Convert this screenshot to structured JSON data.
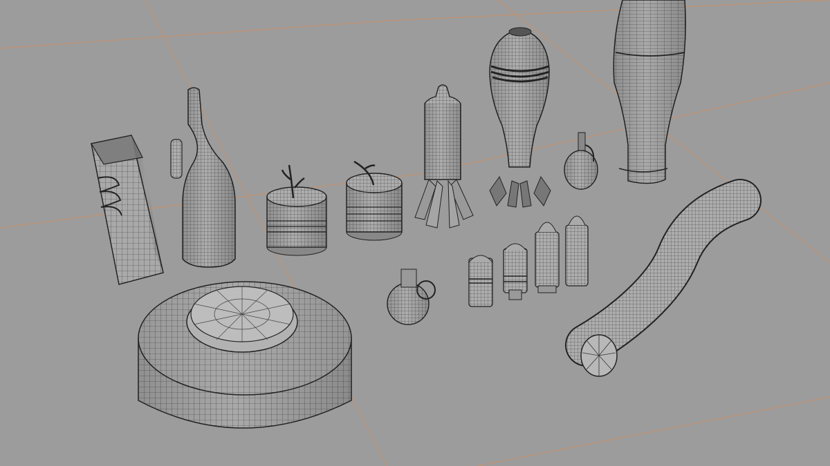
{
  "viewport": {
    "background": "#9c9c9c",
    "grid_color": "#c9926a",
    "mesh_fill": "#a9a9a9",
    "mesh_shade": "#8e8e8e",
    "wire_color": "#2a2a2a"
  },
  "objects": [
    {
      "name": "anti-tank-mine",
      "icon": "landmine-mesh"
    },
    {
      "name": "molotov-bottle",
      "icon": "bottle-mesh"
    },
    {
      "name": "juice-carton-bomb",
      "icon": "carton-mesh"
    },
    {
      "name": "improvised-charge-left",
      "icon": "charge-mesh"
    },
    {
      "name": "improvised-charge-right",
      "icon": "charge-mesh"
    },
    {
      "name": "rocket-projectile",
      "icon": "rocket-mesh"
    },
    {
      "name": "mortar-shell",
      "icon": "mortar-mesh"
    },
    {
      "name": "artillery-shell",
      "icon": "shell-mesh"
    },
    {
      "name": "pineapple-grenade",
      "icon": "grenade-mesh"
    },
    {
      "name": "round-grenade",
      "icon": "grenade-mesh"
    },
    {
      "name": "grenade-round-1",
      "icon": "round-mesh"
    },
    {
      "name": "grenade-round-2",
      "icon": "round-mesh"
    },
    {
      "name": "cartridge-1",
      "icon": "cartridge-mesh"
    },
    {
      "name": "cartridge-2",
      "icon": "cartridge-mesh"
    },
    {
      "name": "detonation-cord",
      "icon": "tube-mesh"
    }
  ]
}
